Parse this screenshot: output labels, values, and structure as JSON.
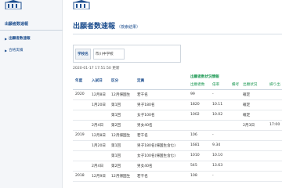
{
  "sidebar": {
    "app_title": "出願者数速報",
    "items": [
      {
        "label": "出願者数速報",
        "active": true
      },
      {
        "label": "合格実績",
        "active": false
      }
    ]
  },
  "header": {
    "title": "出願者数速報",
    "subtitle": "（検索結果）"
  },
  "school": {
    "label": "学校名",
    "value": "市川中学校"
  },
  "updated_at": "2020-01-17 17:51:50 更新",
  "table": {
    "headers": {
      "year": "年度",
      "entrance": "入試日",
      "division": "区分",
      "capacity": "定員",
      "group": "出願者数状況情報",
      "applicants": "出願者数",
      "ratio": "倍率",
      "notes": "備考",
      "results": "出願状況",
      "admission": "繰り出"
    },
    "rows": [
      {
        "year": "2020",
        "date": "12月8日",
        "division": "12月帰国生",
        "capacity": "若干名",
        "applicants": "99",
        "ratio": "-",
        "notes": "",
        "status": "確定",
        "extra": ""
      },
      {
        "year": "",
        "date": "1月20日",
        "division": "第1回",
        "capacity": "男子180名",
        "applicants": "1820",
        "ratio": "10.11",
        "notes": "",
        "status": "確定",
        "extra": ""
      },
      {
        "year": "",
        "date": "",
        "division": "第1回",
        "capacity": "女子100名",
        "applicants": "1002",
        "ratio": "10.02",
        "notes": "",
        "status": "確定",
        "extra": ""
      },
      {
        "year": "",
        "date": "2月4日",
        "division": "第2回",
        "capacity": "男女40名",
        "applicants": "",
        "ratio": "",
        "notes": "",
        "status": "2月3日",
        "extra": "17:00"
      },
      {
        "year": "2019",
        "date": "12月8日",
        "division": "12月帰国生",
        "capacity": "若干名",
        "applicants": "106",
        "ratio": "-",
        "notes": "",
        "status": "",
        "extra": ""
      },
      {
        "year": "",
        "date": "1月20日",
        "division": "第1回",
        "capacity": "男子180名(帰国生含む)",
        "applicants": "1681",
        "ratio": "9.34",
        "notes": "",
        "status": "",
        "extra": ""
      },
      {
        "year": "",
        "date": "",
        "division": "第1回",
        "capacity": "女子100名(帰国生含む)",
        "applicants": "1010",
        "ratio": "10.10",
        "notes": "",
        "status": "",
        "extra": ""
      },
      {
        "year": "",
        "date": "2月4日",
        "division": "第2回",
        "capacity": "男女40名",
        "applicants": "545",
        "ratio": "13.63",
        "notes": "",
        "status": "",
        "extra": ""
      },
      {
        "year": "2018",
        "date": "12月9日",
        "division": "12月帰国生",
        "capacity": "若干名",
        "applicants": "108",
        "ratio": "-",
        "notes": "",
        "status": "",
        "extra": ""
      }
    ]
  },
  "colors": {
    "brand_blue": "#1e4f8f",
    "accent_green": "#1f9a55",
    "sidebar_bg": "#f4f6f9"
  }
}
